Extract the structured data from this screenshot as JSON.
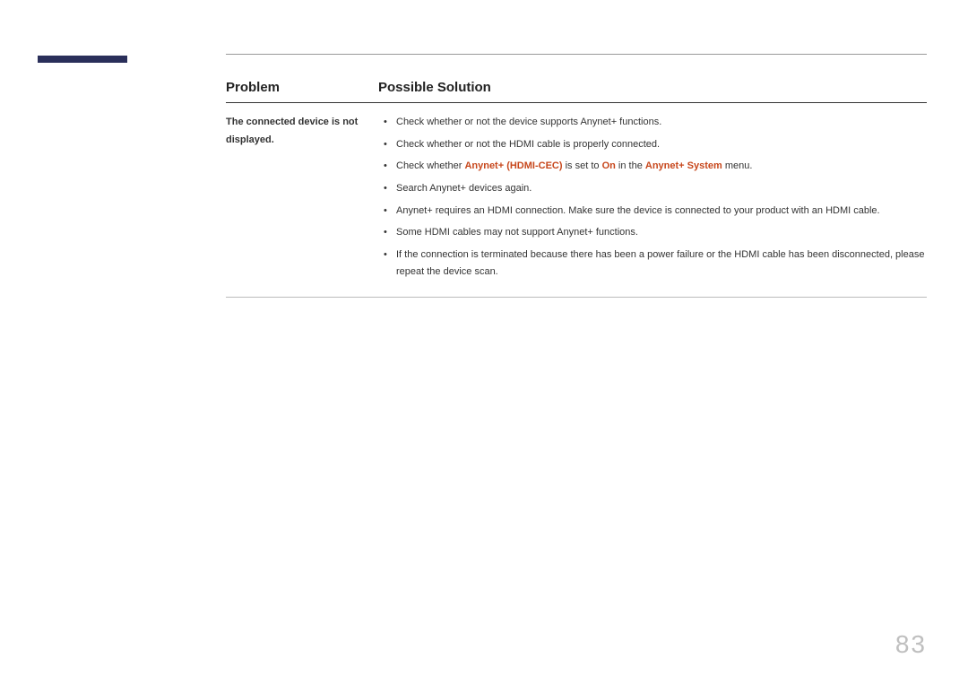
{
  "page_number": "83",
  "headers": {
    "problem": "Problem",
    "solution": "Possible Solution"
  },
  "row": {
    "problem": "The connected device is not displayed.",
    "solutions": {
      "s1": "Check whether or not the device supports Anynet+ functions.",
      "s2": "Check whether or not the HDMI cable is properly connected.",
      "s3_pre": "Check whether ",
      "s3_h1": "Anynet+ (HDMI-CEC)",
      "s3_mid1": " is set to ",
      "s3_h2": "On",
      "s3_mid2": " in the ",
      "s3_h3": "Anynet+ System",
      "s3_post": " menu.",
      "s4": "Search Anynet+ devices again.",
      "s5": "Anynet+ requires an HDMI connection. Make sure the device is connected to your product with an HDMI cable.",
      "s6": "Some HDMI cables may not support Anynet+ functions.",
      "s7": "If the connection is terminated because there has been a power failure or the HDMI cable has been disconnected, please repeat the device scan."
    }
  }
}
